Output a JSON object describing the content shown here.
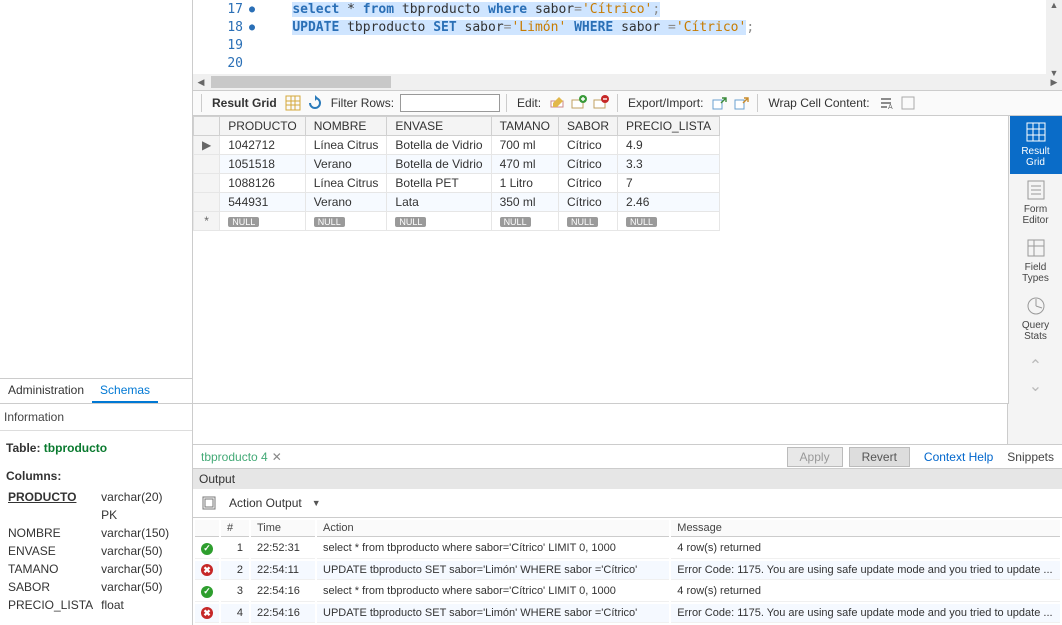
{
  "editor": {
    "lines": [
      {
        "num": 17,
        "dot": true,
        "tokens": [
          {
            "t": "select",
            "c": "kw",
            "sel": true
          },
          {
            "t": " * ",
            "c": "",
            "sel": true
          },
          {
            "t": "from",
            "c": "kw",
            "sel": true
          },
          {
            "t": " tbproducto ",
            "c": "",
            "sel": true
          },
          {
            "t": "where",
            "c": "kw",
            "sel": true
          },
          {
            "t": " sabor",
            "c": "",
            "sel": true
          },
          {
            "t": "=",
            "c": "op",
            "sel": true
          },
          {
            "t": "'Cítrico'",
            "c": "str",
            "sel": true
          },
          {
            "t": ";",
            "c": "op",
            "sel": true
          }
        ]
      },
      {
        "num": 18,
        "dot": true,
        "tokens": [
          {
            "t": "UPDATE",
            "c": "kw",
            "sel": true
          },
          {
            "t": " tbproducto ",
            "c": "",
            "sel": true
          },
          {
            "t": "SET",
            "c": "kw",
            "sel": true
          },
          {
            "t": " sabor",
            "c": "",
            "sel": true
          },
          {
            "t": "=",
            "c": "op",
            "sel": true
          },
          {
            "t": "'Limón'",
            "c": "str",
            "sel": true
          },
          {
            "t": " ",
            "c": "",
            "sel": true
          },
          {
            "t": "WHERE",
            "c": "kw",
            "sel": true
          },
          {
            "t": " sabor ",
            "c": "",
            "sel": true
          },
          {
            "t": "=",
            "c": "op",
            "sel": true
          },
          {
            "t": "'Cítrico'",
            "c": "str",
            "sel": true
          },
          {
            "t": ";",
            "c": "op",
            "sel": false
          }
        ]
      },
      {
        "num": 19,
        "dot": false,
        "tokens": []
      },
      {
        "num": 20,
        "dot": false,
        "tokens": []
      }
    ]
  },
  "leftTabs": {
    "admin": "Administration",
    "schemas": "Schemas"
  },
  "infoPanel": {
    "header": "Information",
    "tableLabel": "Table:",
    "tableName": "tbproducto",
    "columnsLabel": "Columns:",
    "columns": [
      {
        "name": "PRODUCTO",
        "type": "varchar(20)",
        "pk": true,
        "extra": "PK"
      },
      {
        "name": "NOMBRE",
        "type": "varchar(150)"
      },
      {
        "name": "ENVASE",
        "type": "varchar(50)"
      },
      {
        "name": "TAMANO",
        "type": "varchar(50)"
      },
      {
        "name": "SABOR",
        "type": "varchar(50)"
      },
      {
        "name": "PRECIO_LISTA",
        "type": "float"
      }
    ]
  },
  "gridToolbar": {
    "resultGrid": "Result Grid",
    "filterRows": "Filter Rows:",
    "filterValue": "",
    "edit": "Edit:",
    "exportImport": "Export/Import:",
    "wrap": "Wrap Cell Content:"
  },
  "resultGrid": {
    "headers": [
      "PRODUCTO",
      "NOMBRE",
      "ENVASE",
      "TAMANO",
      "SABOR",
      "PRECIO_LISTA"
    ],
    "rows": [
      [
        "1042712",
        "Línea Citrus",
        "Botella de Vidrio",
        "700 ml",
        "Cítrico",
        "4.9"
      ],
      [
        "1051518",
        "Verano",
        "Botella de Vidrio",
        "470 ml",
        "Cítrico",
        "3.3"
      ],
      [
        "1088126",
        "Línea Citrus",
        "Botella PET",
        "1 Litro",
        "Cítrico",
        "7"
      ],
      [
        "544931",
        "Verano",
        "Lata",
        "350 ml",
        "Cítrico",
        "2.46"
      ]
    ],
    "nullLabel": "NULL"
  },
  "sideTools": {
    "resultGrid1": "Result",
    "resultGrid2": "Grid",
    "formEditor1": "Form",
    "formEditor2": "Editor",
    "fieldTypes1": "Field",
    "fieldTypes2": "Types",
    "queryStats1": "Query",
    "queryStats2": "Stats"
  },
  "tabBar": {
    "tabLabel": "tbproducto 4",
    "apply": "Apply",
    "revert": "Revert",
    "contextHelp": "Context Help",
    "snippets": "Snippets"
  },
  "outputPanel": {
    "header": "Output",
    "selectLabel": "Action Output",
    "columns": {
      "idx": "#",
      "time": "Time",
      "action": "Action",
      "message": "Message"
    },
    "rows": [
      {
        "status": "ok",
        "idx": "1",
        "time": "22:52:31",
        "action": "select * from tbproducto where sabor='Cítrico' LIMIT 0, 1000",
        "message": "4 row(s) returned"
      },
      {
        "status": "err",
        "idx": "2",
        "time": "22:54:11",
        "action": "UPDATE tbproducto SET sabor='Limón' WHERE sabor ='Cítrico'",
        "message": "Error Code: 1175. You are using safe update mode and you tried to update ..."
      },
      {
        "status": "ok",
        "idx": "3",
        "time": "22:54:16",
        "action": "select * from tbproducto where sabor='Cítrico' LIMIT 0, 1000",
        "message": "4 row(s) returned"
      },
      {
        "status": "err",
        "idx": "4",
        "time": "22:54:16",
        "action": "UPDATE tbproducto SET sabor='Limón' WHERE sabor ='Cítrico'",
        "message": "Error Code: 1175. You are using safe update mode and you tried to update ..."
      }
    ]
  }
}
